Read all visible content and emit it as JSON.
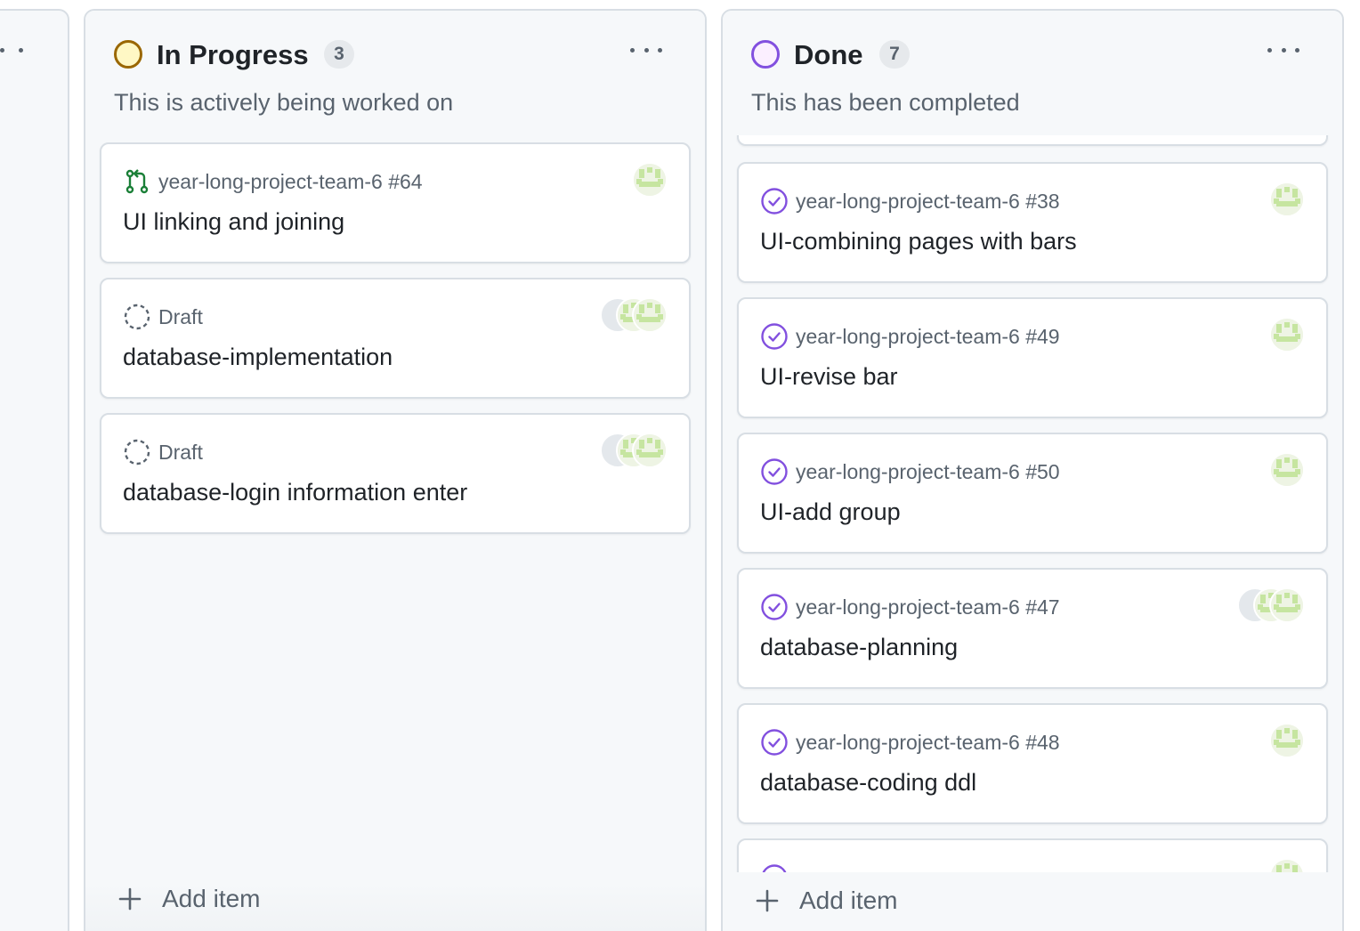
{
  "colors": {
    "in_progress_ring": "#9a6700",
    "in_progress_fill": "#fff8c5",
    "done_ring": "#8250df",
    "done_fill": "#fbefff",
    "pr_open_green": "#1a7f37",
    "issue_closed_purple": "#8250df",
    "draft_gray": "#59636e"
  },
  "columns": {
    "in_progress": {
      "title": "In Progress",
      "count": "3",
      "description": "This is actively being worked on",
      "add_item_label": "Add item",
      "cards": [
        {
          "icon": "pull-request-icon",
          "meta": "year-long-project-team-6 #64",
          "title": "UI linking and joining"
        },
        {
          "icon": "draft-icon",
          "meta": "Draft",
          "title": "database-implementation"
        },
        {
          "icon": "draft-icon",
          "meta": "Draft",
          "title": "database-login information enter"
        }
      ]
    },
    "done": {
      "title": "Done",
      "count": "7",
      "description": "This has been completed",
      "add_item_label": "Add item",
      "cards": [
        {
          "icon": "issue-closed-icon",
          "meta": "year-long-project-team-6 #38",
          "title": "UI-combining pages with bars"
        },
        {
          "icon": "issue-closed-icon",
          "meta": "year-long-project-team-6 #49",
          "title": "UI-revise bar"
        },
        {
          "icon": "issue-closed-icon",
          "meta": "year-long-project-team-6 #50",
          "title": "UI-add group"
        },
        {
          "icon": "issue-closed-icon",
          "meta": "year-long-project-team-6 #47",
          "title": "database-planning"
        },
        {
          "icon": "issue-closed-icon",
          "meta": "year-long-project-team-6 #48",
          "title": "database-coding ddl"
        }
      ]
    }
  }
}
